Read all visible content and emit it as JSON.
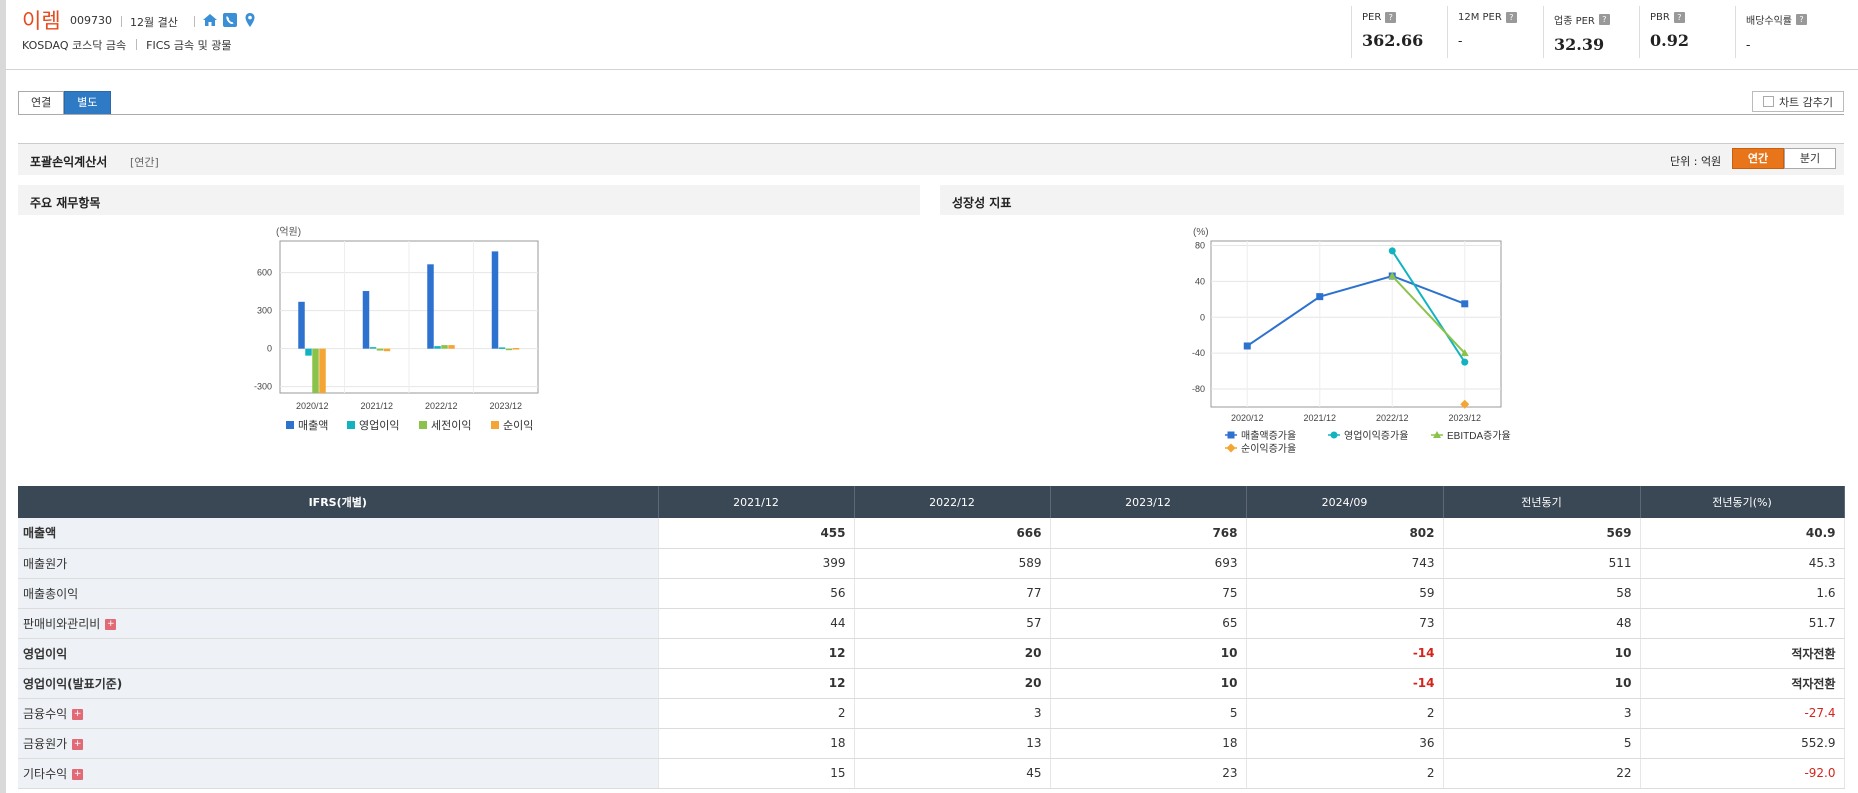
{
  "company": {
    "name": "이렘",
    "code": "009730",
    "fiscal": "12월 결산",
    "market": "KOSDAQ  코스닥 금속",
    "fics": "FICS 금속 및 광물"
  },
  "metrics": [
    {
      "label": "PER",
      "value": "362.66"
    },
    {
      "label": "12M PER",
      "value": "-"
    },
    {
      "label": "업종 PER",
      "value": "32.39"
    },
    {
      "label": "PBR",
      "value": "0.92"
    },
    {
      "label": "배당수익률",
      "value": "-"
    }
  ],
  "tabs": [
    "연결",
    "별도"
  ],
  "active_tab": "별도",
  "chart_hide_label": "차트 감추기",
  "section": {
    "title": "포괄손익계산서",
    "sub": "[연간]",
    "unit_label": "단위 : 억원",
    "period_buttons": [
      "연간",
      "분기"
    ]
  },
  "panels": {
    "left_title": "주요 재무항목",
    "right_title": "성장성 지표"
  },
  "colors": {
    "accent_orange": "#e9751b",
    "tab_blue": "#2f7ac4",
    "header_dark": "#3a4754",
    "negative_red": "#d4251d"
  },
  "chart_data": [
    {
      "type": "bar",
      "unit_label": "(억원)",
      "categories": [
        "2020/12",
        "2021/12",
        "2022/12",
        "2023/12"
      ],
      "ylim": [
        -350,
        850
      ],
      "yticks": [
        -300,
        0,
        300,
        600
      ],
      "grid": true,
      "legend_position": "bottom",
      "series": [
        {
          "name": "매출액",
          "color": "#2e72cf",
          "values": [
            370,
            455,
            666,
            768
          ]
        },
        {
          "name": "영업이익",
          "color": "#12b3c0",
          "values": [
            -55,
            12,
            20,
            10
          ]
        },
        {
          "name": "세전이익",
          "color": "#8bc34a",
          "values": [
            -350,
            -15,
            28,
            0
          ]
        },
        {
          "name": "순이익",
          "color": "#f4a533",
          "values": [
            -350,
            -20,
            28,
            5
          ]
        }
      ]
    },
    {
      "type": "line",
      "unit_label": "(%)",
      "categories": [
        "2020/12",
        "2021/12",
        "2022/12",
        "2023/12"
      ],
      "ylim": [
        -100,
        85
      ],
      "yticks": [
        -80,
        -40,
        0,
        40,
        80
      ],
      "grid": true,
      "legend_position": "bottom",
      "series": [
        {
          "name": "매출액증가율",
          "color": "#2e72cf",
          "marker": "square",
          "values": [
            -32,
            23,
            46,
            15
          ]
        },
        {
          "name": "영업이익증가율",
          "color": "#12b3c0",
          "marker": "circle",
          "values": [
            null,
            null,
            74,
            -50
          ]
        },
        {
          "name": "EBITDA증가율",
          "color": "#8bc34a",
          "marker": "triangle",
          "values": [
            null,
            null,
            46,
            -40
          ]
        },
        {
          "name": "순이익증가율",
          "color": "#f4a533",
          "marker": "diamond",
          "values": [
            null,
            null,
            null,
            -97
          ]
        }
      ]
    }
  ],
  "table": {
    "columns": [
      "IFRS(개별)",
      "2021/12",
      "2022/12",
      "2023/12",
      "2024/09",
      "전년동기",
      "전년동기(%)"
    ],
    "rows": [
      {
        "label": "매출액",
        "bold": true,
        "expand": false,
        "values": [
          "455",
          "666",
          "768",
          "802",
          "569",
          "40.9"
        ],
        "neg": []
      },
      {
        "label": "매출원가",
        "bold": false,
        "expand": false,
        "values": [
          "399",
          "589",
          "693",
          "743",
          "511",
          "45.3"
        ],
        "neg": []
      },
      {
        "label": "매출총이익",
        "bold": false,
        "expand": false,
        "values": [
          "56",
          "77",
          "75",
          "59",
          "58",
          "1.6"
        ],
        "neg": []
      },
      {
        "label": "판매비와관리비",
        "bold": false,
        "expand": true,
        "values": [
          "44",
          "57",
          "65",
          "73",
          "48",
          "51.7"
        ],
        "neg": []
      },
      {
        "label": "영업이익",
        "bold": true,
        "expand": false,
        "values": [
          "12",
          "20",
          "10",
          "-14",
          "10",
          "적자전환"
        ],
        "neg": [
          3
        ]
      },
      {
        "label": "영업이익(발표기준)",
        "bold": true,
        "expand": false,
        "values": [
          "12",
          "20",
          "10",
          "-14",
          "10",
          "적자전환"
        ],
        "neg": [
          3
        ]
      },
      {
        "label": "금융수익",
        "bold": false,
        "expand": true,
        "values": [
          "2",
          "3",
          "5",
          "2",
          "3",
          "-27.4"
        ],
        "neg": [
          5
        ]
      },
      {
        "label": "금융원가",
        "bold": false,
        "expand": true,
        "values": [
          "18",
          "13",
          "18",
          "36",
          "5",
          "552.9"
        ],
        "neg": []
      },
      {
        "label": "기타수익",
        "bold": false,
        "expand": true,
        "values": [
          "15",
          "45",
          "23",
          "2",
          "22",
          "-92.0"
        ],
        "neg": [
          5
        ]
      }
    ]
  }
}
